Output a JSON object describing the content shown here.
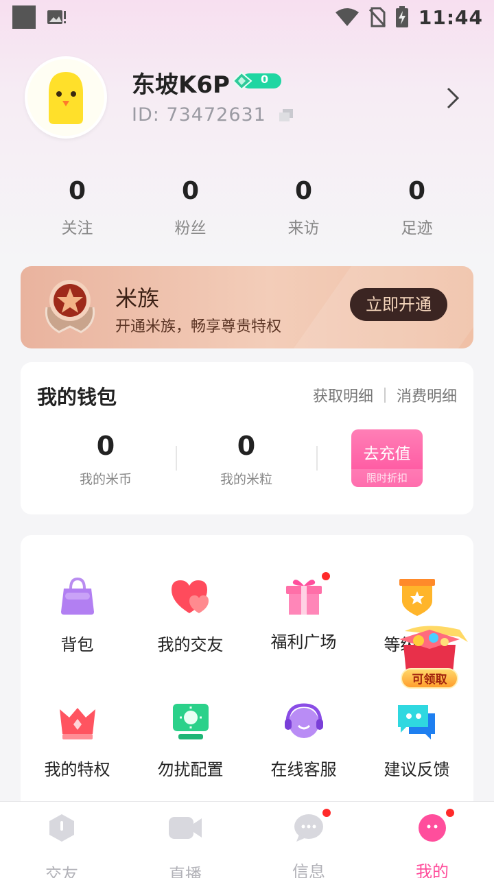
{
  "status_bar": {
    "time": "11:44"
  },
  "profile": {
    "nickname": "东坡K6P",
    "level": "0",
    "id_text": "ID: 73472631"
  },
  "stats": [
    {
      "value": "0",
      "label": "关注"
    },
    {
      "value": "0",
      "label": "粉丝"
    },
    {
      "value": "0",
      "label": "来访"
    },
    {
      "value": "0",
      "label": "足迹"
    }
  ],
  "vip": {
    "title": "米族",
    "subtitle": "开通米族，畅享尊贵特权",
    "button": "立即开通"
  },
  "wallet": {
    "title": "我的钱包",
    "link_income": "获取明细",
    "link_spend": "消费明细",
    "coins_value": "0",
    "coins_label": "我的米币",
    "grains_value": "0",
    "grains_label": "我的米粒",
    "recharge_label": "去充值",
    "recharge_sub": "限时折扣"
  },
  "features": [
    {
      "label": "背包",
      "icon": "bag-icon"
    },
    {
      "label": "我的交友",
      "icon": "hearts-icon"
    },
    {
      "label": "福利广场",
      "icon": "gift-icon"
    },
    {
      "label": "等级特权",
      "icon": "level-shield-icon"
    },
    {
      "label": "我的特权",
      "icon": "crown-icon"
    },
    {
      "label": "勿扰配置",
      "icon": "do-not-disturb-icon"
    },
    {
      "label": "在线客服",
      "icon": "headset-icon"
    },
    {
      "label": "建议反馈",
      "icon": "feedback-chat-icon"
    }
  ],
  "claim_badge": "可领取",
  "tabs": [
    {
      "label": "交友"
    },
    {
      "label": "直播"
    },
    {
      "label": "信息"
    },
    {
      "label": "我的"
    }
  ],
  "colors": {
    "accent_pink": "#ff4e9c",
    "vip_gold": "#e9b39e",
    "tab_inactive": "#b2b2b8"
  }
}
